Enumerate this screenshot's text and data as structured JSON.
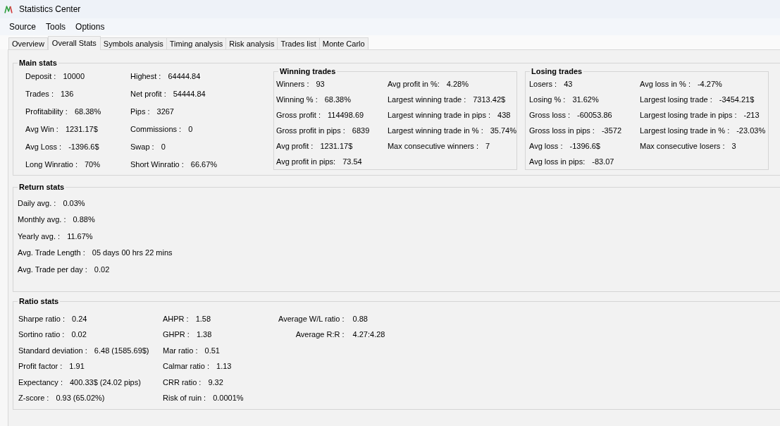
{
  "window": {
    "title": "Statistics Center"
  },
  "menu": [
    "Source",
    "Tools",
    "Options"
  ],
  "tabs": [
    {
      "label": "Overview",
      "selected": false
    },
    {
      "label": "Overall Stats",
      "selected": true
    },
    {
      "label": "Symbols analysis",
      "selected": false
    },
    {
      "label": "Timing analysis",
      "selected": false
    },
    {
      "label": "Risk analysis",
      "selected": false
    },
    {
      "label": "Trades list",
      "selected": false
    },
    {
      "label": "Monte Carlo",
      "selected": false
    }
  ],
  "main_stats": {
    "title": "Main stats",
    "columns": [
      [
        {
          "label": "Deposit :",
          "value": "10000"
        },
        {
          "label": "Trades :",
          "value": "136"
        },
        {
          "label": "Profitability :",
          "value": "68.38%"
        },
        {
          "label": "Avg Win :",
          "value": "1231.17$"
        },
        {
          "label": "Avg Loss :",
          "value": "-1396.6$"
        },
        {
          "label": "Long Winratio :",
          "value": "70%"
        }
      ],
      [
        {
          "label": "Highest :",
          "value": "64444.84"
        },
        {
          "label": "Net profit :",
          "value": "54444.84"
        },
        {
          "label": "Pips :",
          "value": "3267"
        },
        {
          "label": "Commissions :",
          "value": "0"
        },
        {
          "label": "Swap :",
          "value": "0"
        },
        {
          "label": "Short Winratio :",
          "value": "66.67%"
        }
      ]
    ]
  },
  "winning_trades": {
    "title": "Winning trades",
    "columns": [
      [
        {
          "label": "Winners :",
          "value": "93"
        },
        {
          "label": "Winning % :",
          "value": "68.38%"
        },
        {
          "label": "Gross profit :",
          "value": "114498.69"
        },
        {
          "label": "Gross profit in pips :",
          "value": "6839"
        },
        {
          "label": "Avg profit :",
          "value": "1231.17$"
        },
        {
          "label": "Avg profit in pips:",
          "value": "73.54"
        }
      ],
      [
        {
          "label": "Avg profit in %:",
          "value": "4.28%"
        },
        {
          "label": "Largest winning trade :",
          "value": "7313.42$"
        },
        {
          "label": "Largest winning trade in pips :",
          "value": "438"
        },
        {
          "label": "Largest winning trade in % :",
          "value": "35.74%"
        },
        {
          "label": "Max consecutive winners :",
          "value": "7"
        }
      ]
    ]
  },
  "losing_trades": {
    "title": "Losing trades",
    "columns": [
      [
        {
          "label": "Losers :",
          "value": "43"
        },
        {
          "label": "Losing % :",
          "value": "31.62%"
        },
        {
          "label": "Gross loss :",
          "value": "-60053.86"
        },
        {
          "label": "Gross loss in pips :",
          "value": "-3572"
        },
        {
          "label": "Avg loss :",
          "value": "-1396.6$"
        },
        {
          "label": "Avg loss in pips:",
          "value": "-83.07"
        }
      ],
      [
        {
          "label": "Avg loss in % :",
          "value": "-4.27%"
        },
        {
          "label": "Largest losing trade :",
          "value": "-3454.21$"
        },
        {
          "label": "Largest losing trade in pips :",
          "value": "-213"
        },
        {
          "label": "Largest losing trade in % :",
          "value": "-23.03%"
        },
        {
          "label": "Max consecutive losers :",
          "value": "3"
        }
      ]
    ]
  },
  "return_stats": {
    "title": "Return stats",
    "rows": [
      {
        "label": "Daily avg. :",
        "value": "0.03%"
      },
      {
        "label": "Monthly avg. :",
        "value": "0.88%"
      },
      {
        "label": "Yearly avg. :",
        "value": "11.67%"
      },
      {
        "label": "Avg. Trade Length :",
        "value": "05 days 00 hrs 22 mins"
      },
      {
        "label": "Avg. Trade per day :",
        "value": "0.02"
      }
    ]
  },
  "ratio_stats": {
    "title": "Ratio stats",
    "columns": [
      [
        {
          "label": "Sharpe ratio :",
          "value": "0.24"
        },
        {
          "label": "Sortino ratio :",
          "value": "0.02"
        },
        {
          "label": "Standard deviation :",
          "value": "6.48 (1585.69$)"
        },
        {
          "label": "Profit factor :",
          "value": "1.91"
        },
        {
          "label": "Expectancy :",
          "value": "400.33$ (24.02 pips)"
        },
        {
          "label": "Z-score :",
          "value": "0.93 (65.02%)"
        }
      ],
      [
        {
          "label": "AHPR :",
          "value": "1.58"
        },
        {
          "label": "GHPR :",
          "value": "1.38"
        },
        {
          "label": "Mar ratio :",
          "value": "0.51"
        },
        {
          "label": "Calmar ratio :",
          "value": "1.13"
        },
        {
          "label": "CRR ratio :",
          "value": "9.32"
        },
        {
          "label": "Risk of ruin :",
          "value": "0.0001%"
        }
      ],
      [
        {
          "label": "Average W/L ratio :",
          "value": "0.88"
        },
        {
          "label": "Average R:R :",
          "value": "4.27:4.28"
        }
      ]
    ]
  }
}
